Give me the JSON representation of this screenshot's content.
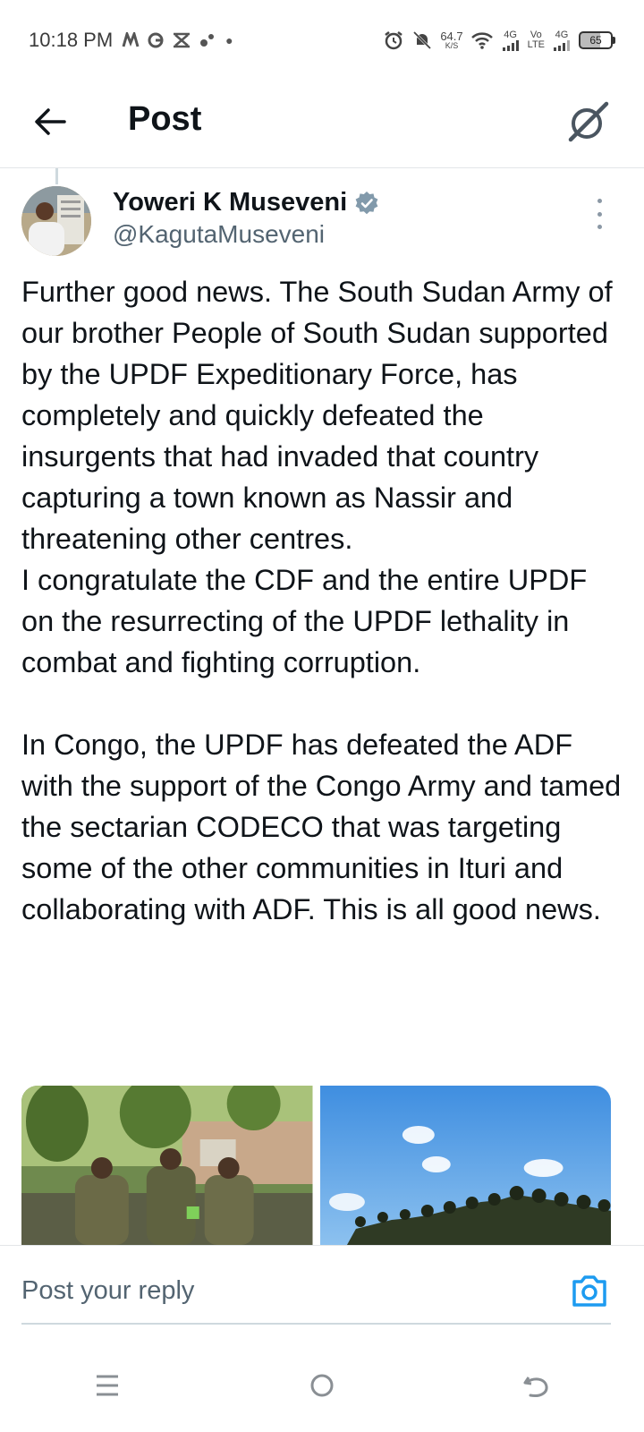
{
  "status_bar": {
    "time": "10:18 PM",
    "speed_value": "64.7",
    "speed_unit": "K/S",
    "net1": "4G",
    "net2_top": "Vo",
    "net2_bottom": "LTE",
    "net3": "4G",
    "battery": "65"
  },
  "header": {
    "title": "Post",
    "back_icon": "arrow-left-icon",
    "grok_icon": "grok-icon"
  },
  "tweet": {
    "author_name": "Yoweri K Museveni",
    "author_handle": "@KagutaMuseveni",
    "paragraphs": [
      "Further good news. The South Sudan Army of our brother People of South Sudan supported by the UPDF Expeditionary Force, has completely and quickly defeated the insurgents that had invaded that country capturing a town known as Nassir and threatening other centres.\nI congratulate the CDF and the entire UPDF on the resurrecting of the UPDF lethality in combat and fighting corruption.",
      "In Congo, the UPDF has defeated the ADF with the support of the Congo Army and tamed the sectarian CODECO that was targeting some of the other communities in Ituri and collaborating with ADF. This is all good news."
    ],
    "verified_color": "#829aab"
  },
  "reply": {
    "placeholder": "Post your reply",
    "camera_color": "#1d9bf0"
  },
  "nav": {
    "icons": [
      "menu-icon",
      "home-circle-icon",
      "back-arrow-icon"
    ]
  }
}
